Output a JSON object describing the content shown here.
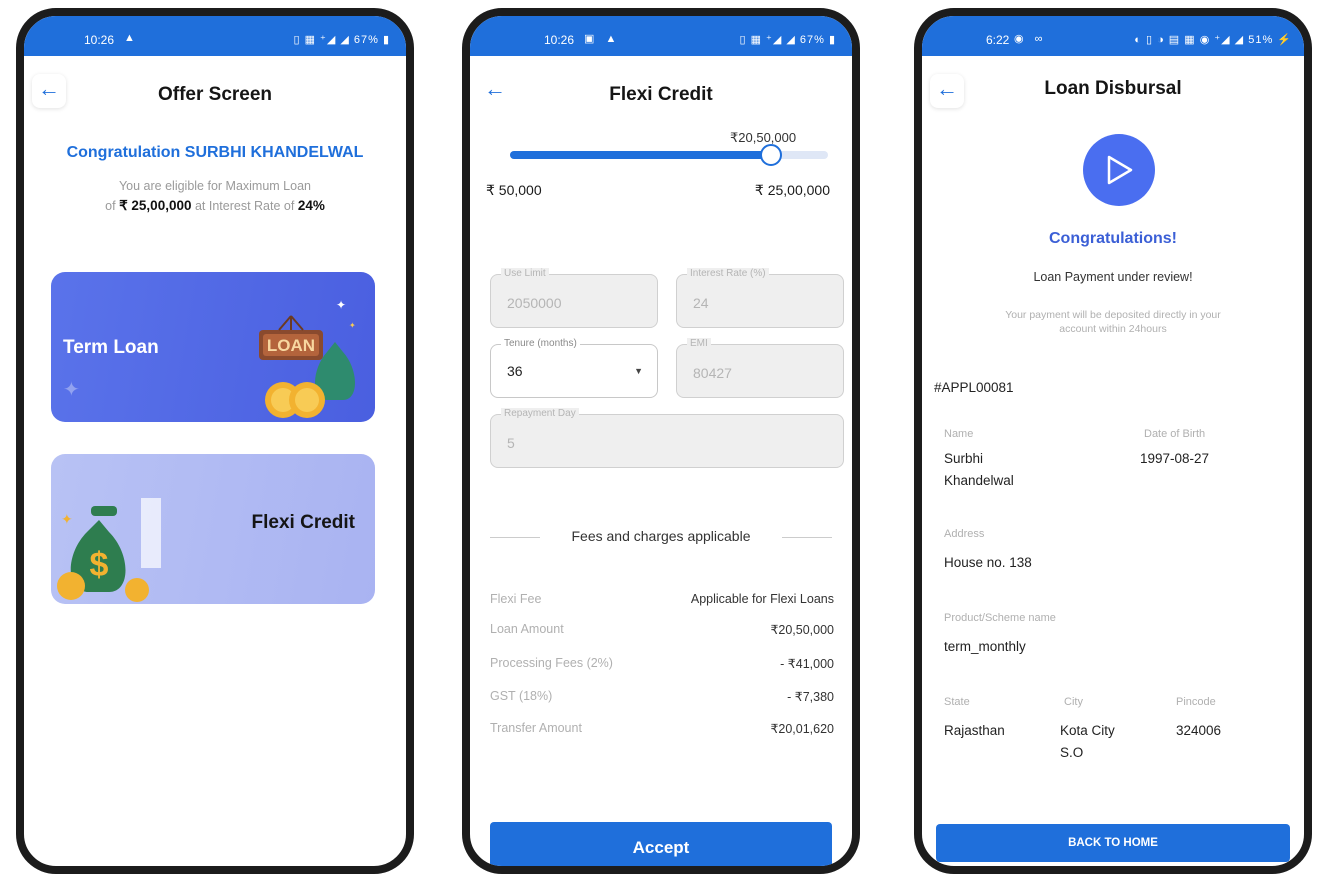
{
  "screens": {
    "offer": {
      "status": {
        "time": "10:26",
        "battery": "67%"
      },
      "title": "Offer Screen",
      "congrats": "Congratulation SURBHI KHANDELWAL",
      "eligible_prefix": "You are eligible for Maximum Loan",
      "eligible_of": "of",
      "max_loan": "₹ 25,00,000",
      "rate_text": "at Interest Rate of",
      "rate": "24%",
      "cards": {
        "term": "Term Loan",
        "term_art": "LOAN",
        "flexi": "Flexi Credit"
      }
    },
    "flexi": {
      "status": {
        "time": "10:26",
        "battery": "67%"
      },
      "title": "Flexi Credit",
      "slider": {
        "current": "₹20,50,000",
        "fraction": 0.82,
        "min": "₹ 50,000",
        "max": "₹ 25,00,000"
      },
      "fields": {
        "loan_amount": {
          "label": "Use Limit",
          "value": "2050000"
        },
        "interest": {
          "label": "Interest Rate (%)",
          "value": "24"
        },
        "tenure": {
          "label": "Tenure (months)",
          "value": "36"
        },
        "emi": {
          "label": "EMI",
          "value": "80427"
        },
        "repayment": {
          "label": "Repayment Day",
          "value": "5"
        }
      },
      "fees_title": "Fees and charges applicable",
      "fees": [
        {
          "k": "Flexi Fee",
          "v": "Applicable for Flexi Loans"
        },
        {
          "k": "Loan Amount",
          "v": "₹20,50,000"
        },
        {
          "k": "Processing Fees (2%)",
          "v": "- ₹41,000"
        },
        {
          "k": "GST (18%)",
          "v": "- ₹7,380"
        },
        {
          "k": "Transfer Amount",
          "v": "₹20,01,620"
        }
      ],
      "accept": "Accept"
    },
    "disbursal": {
      "status": {
        "time": "6:22",
        "battery": "51%"
      },
      "title": "Loan Disbursal",
      "congrats": "Congratulations!",
      "review": "Loan Payment under review!",
      "deposit": "Your payment will be deposited directly in your account within 24hours",
      "app_id": "#APPL00081",
      "name_label": "Name",
      "name_first": "Surbhi",
      "name_last": "Khandelwal",
      "dob_label": "Date of Birth",
      "dob": "1997-08-27",
      "address_label": "Address",
      "address": "House no. 138",
      "product_label": "Product/Scheme name",
      "product": "term_monthly",
      "state_label": "State",
      "state": "Rajasthan",
      "city_label": "City",
      "city_line1": "Kota City",
      "city_line2": "S.O",
      "pin_label": "Pincode",
      "pin": "324006",
      "button": "BACK TO HOME"
    }
  },
  "colors": {
    "primary": "#1f6fdb",
    "term_card": "#5a73ea",
    "flexi_card": "#b8c2f4",
    "accent_text": "#3b5fd6"
  }
}
